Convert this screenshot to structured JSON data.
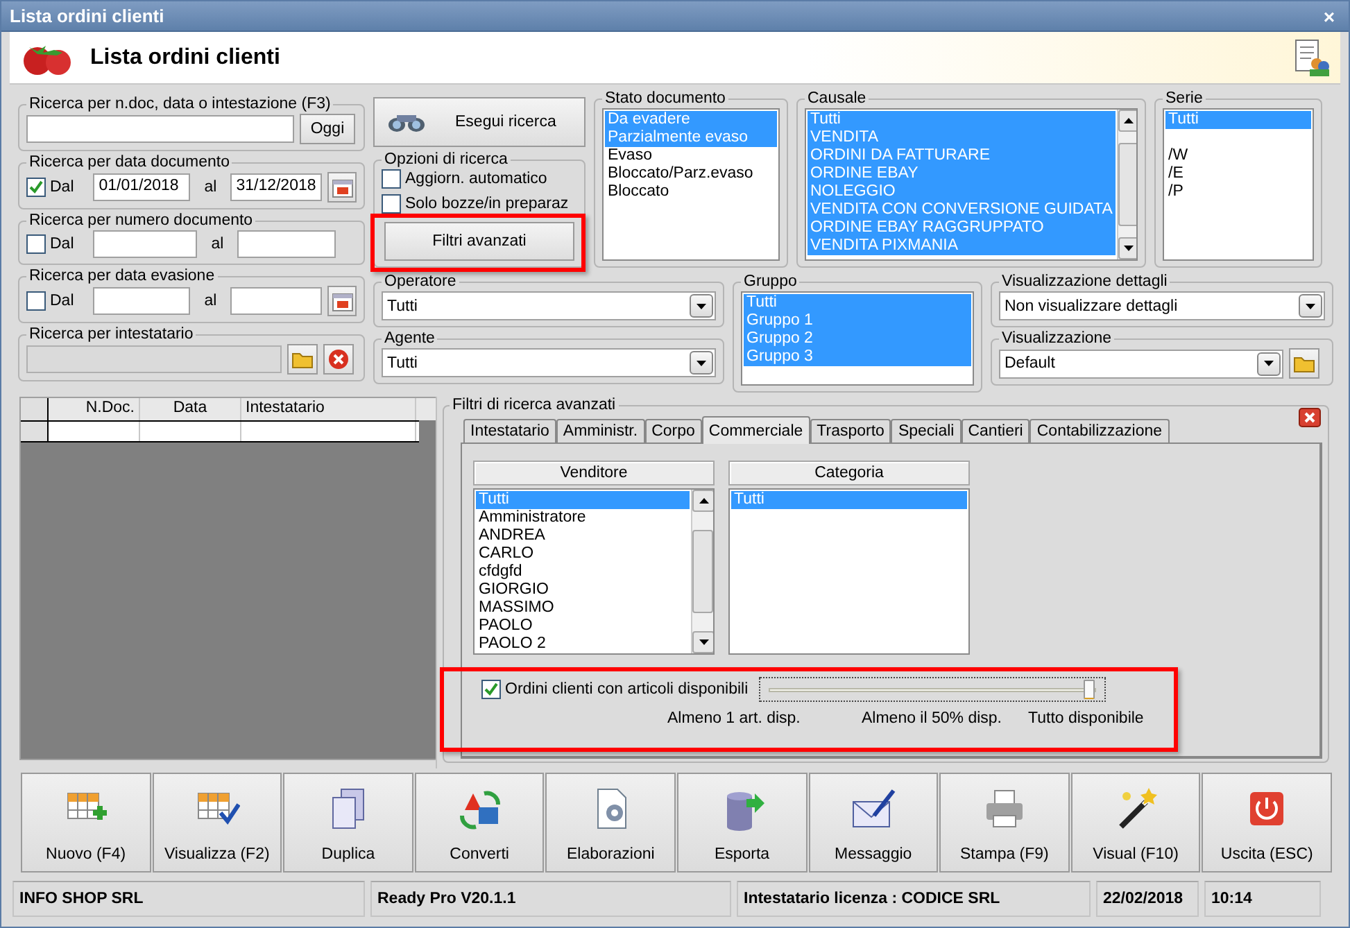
{
  "window": {
    "title": "Lista ordini clienti",
    "close": "×"
  },
  "header": {
    "title": "Lista ordini clienti"
  },
  "quick_search": {
    "label": "Ricerca per n.doc, data o intestazione (F3)",
    "button": "Oggi"
  },
  "range_searches": [
    {
      "label": "Ricerca per data documento",
      "checkbox": "Dal",
      "checked": true,
      "from": "01/01/2018",
      "to_label": "al",
      "to": "31/12/2018",
      "calendar": true
    },
    {
      "label": "Ricerca per numero documento",
      "checkbox": "Dal",
      "checked": false,
      "to_label": "al",
      "calendar": false
    },
    {
      "label": "Ricerca per data evasione",
      "checkbox": "Dal",
      "checked": false,
      "to_label": "al",
      "calendar": true
    }
  ],
  "owner_search": {
    "label": "Ricerca per intestatario",
    "disabled": true
  },
  "search_button": "Esegui ricerca",
  "search_options": {
    "label": "Opzioni di ricerca",
    "items": [
      {
        "label": "Aggiorn. automatico",
        "checked": false
      },
      {
        "label": "Solo bozze/in preparaz",
        "checked": false
      }
    ]
  },
  "advanced_button": "Filtri avanzati",
  "lists": [
    {
      "label": "Stato documento",
      "scrollbar": false,
      "items": [
        {
          "text": "Da evadere",
          "selected": true
        },
        {
          "text": "Parzialmente evaso",
          "selected": true
        },
        {
          "text": "Evaso",
          "selected": false
        },
        {
          "text": "Bloccato/Parz.evaso",
          "selected": false
        },
        {
          "text": "Bloccato",
          "selected": false
        }
      ]
    },
    {
      "label": "Causale",
      "scrollbar": true,
      "items": [
        {
          "text": "Tutti",
          "selected": true
        },
        {
          "text": "VENDITA",
          "selected": true
        },
        {
          "text": "ORDINI DA FATTURARE",
          "selected": true
        },
        {
          "text": "ORDINE EBAY",
          "selected": true
        },
        {
          "text": "NOLEGGIO",
          "selected": true
        },
        {
          "text": "VENDITA CON CONVERSIONE GUIDATA",
          "selected": true
        },
        {
          "text": "ORDINE EBAY RAGGRUPPATO",
          "selected": true
        },
        {
          "text": "VENDITA PIXMANIA",
          "selected": true
        }
      ]
    },
    {
      "label": "Serie",
      "scrollbar": false,
      "items": [
        {
          "text": "Tutti",
          "selected": true
        },
        {
          "selected": false
        },
        {
          "text": "/W",
          "selected": false
        },
        {
          "text": "/E",
          "selected": false
        },
        {
          "text": "/P",
          "selected": false
        }
      ]
    }
  ],
  "operator": {
    "label": "Operatore",
    "value": "Tutti"
  },
  "agent": {
    "label": "Agente",
    "value": "Tutti"
  },
  "group": {
    "label": "Gruppo",
    "items": [
      {
        "text": "Tutti",
        "selected": true
      },
      {
        "text": "Gruppo 1",
        "selected": true
      },
      {
        "text": "Gruppo 2",
        "selected": true
      },
      {
        "text": "Gruppo 3",
        "selected": true
      }
    ]
  },
  "details_view": {
    "label": "Visualizzazione dettagli",
    "value": "Non visualizzare dettagli"
  },
  "view": {
    "label": "Visualizzazione",
    "value": "Default"
  },
  "table": {
    "columns": [
      "N.Doc.",
      "Data",
      "Intestatario"
    ]
  },
  "advanced_filters": {
    "title": "Filtri di ricerca avanzati",
    "tabs": [
      {
        "label": "Intestatario",
        "selected": false
      },
      {
        "label": "Amministr.",
        "selected": false
      },
      {
        "label": "Corpo",
        "selected": false
      },
      {
        "label": "Commerciale",
        "selected": true
      },
      {
        "label": "Trasporto",
        "selected": false
      },
      {
        "label": "Speciali",
        "selected": false
      },
      {
        "label": "Cantieri",
        "selected": false
      },
      {
        "label": "Contabilizzazione",
        "selected": false
      }
    ],
    "lists": [
      {
        "header": "Venditore",
        "scrollbar": true,
        "items": [
          {
            "text": "Tutti",
            "selected": true
          },
          {
            "text": "Amministratore",
            "selected": false
          },
          {
            "text": "ANDREA",
            "selected": false
          },
          {
            "text": "CARLO",
            "selected": false
          },
          {
            "text": "cfdgfd",
            "selected": false
          },
          {
            "text": "GIORGIO",
            "selected": false
          },
          {
            "text": "MASSIMO",
            "selected": false
          },
          {
            "text": "PAOLO",
            "selected": false
          },
          {
            "text": "PAOLO 2",
            "selected": false
          }
        ]
      },
      {
        "header": "Categoria",
        "scrollbar": false,
        "items": [
          {
            "text": "Tutti",
            "selected": true
          }
        ]
      }
    ],
    "availability": {
      "label": "Ordini clienti con articoli disponibili",
      "checked": true,
      "level": 1,
      "ticks": [
        "Almeno 1 art. disp.",
        "Almeno il 50% disp.",
        "Tutto disponibile"
      ]
    }
  },
  "toolbar": [
    {
      "label": "Nuovo (F4)",
      "kind": "new"
    },
    {
      "label": "Visualizza (F2)",
      "kind": "view"
    },
    {
      "label": "Duplica",
      "kind": "duplicate"
    },
    {
      "label": "Converti",
      "kind": "convert"
    },
    {
      "label": "Elaborazioni",
      "kind": "process"
    },
    {
      "label": "Esporta",
      "kind": "export"
    },
    {
      "label": "Messaggio",
      "kind": "message"
    },
    {
      "label": "Stampa (F9)",
      "kind": "print"
    },
    {
      "label": "Visual (F10)",
      "kind": "visual"
    },
    {
      "label": "Uscita (ESC)",
      "kind": "exit"
    }
  ],
  "status_bar": [
    "INFO SHOP SRL",
    "Ready Pro V20.1.1",
    "Intestatario licenza : CODICE SRL",
    "22/02/2018",
    "10:14"
  ]
}
